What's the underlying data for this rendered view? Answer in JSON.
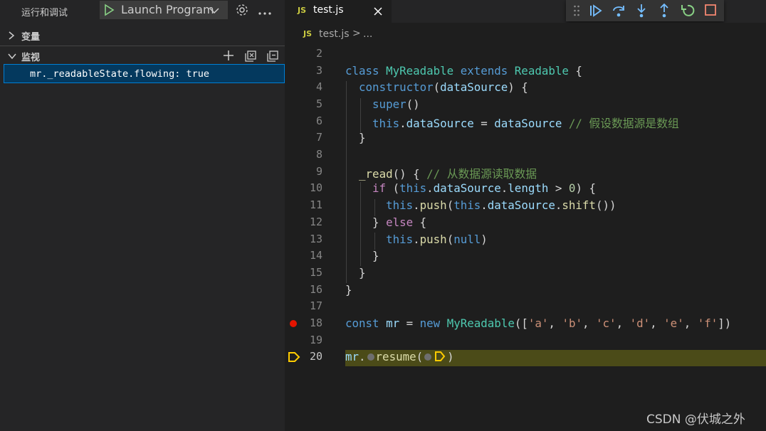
{
  "left_panel": {
    "run_title": "运行和调试",
    "launch_config": "Launch Program",
    "sections": {
      "variables": "变量",
      "watch": "监视"
    },
    "watch_items": [
      {
        "expr": "mr._readableState.flowing",
        "value": "true",
        "display": "mr._readableState.flowing: true"
      }
    ]
  },
  "editor": {
    "tab": {
      "icon": "JS",
      "name": "test.js"
    },
    "breadcrumb": {
      "icon": "JS",
      "file": "test.js",
      "separator": ">",
      "more": "..."
    },
    "breakpoint_line": 18,
    "current_line": 20,
    "lines": [
      {
        "n": "2"
      },
      {
        "n": "3"
      },
      {
        "n": "4"
      },
      {
        "n": "5"
      },
      {
        "n": "6"
      },
      {
        "n": "7"
      },
      {
        "n": "8"
      },
      {
        "n": "9"
      },
      {
        "n": "10"
      },
      {
        "n": "11"
      },
      {
        "n": "12"
      },
      {
        "n": "13"
      },
      {
        "n": "14"
      },
      {
        "n": "15"
      },
      {
        "n": "16"
      },
      {
        "n": "17"
      },
      {
        "n": "18"
      },
      {
        "n": "19"
      },
      {
        "n": "20"
      }
    ],
    "code": {
      "l3": {
        "t1": "class",
        "t2": "MyReadable",
        "t3": "extends",
        "t4": "Readable",
        "t5": " {"
      },
      "l4": {
        "t1": "constructor",
        "t2": "(",
        "t3": "dataSource",
        "t4": ") {"
      },
      "l5": {
        "t1": "super",
        "t2": "()"
      },
      "l6": {
        "t1": "this",
        "t2": ".",
        "t3": "dataSource",
        "t4": " = ",
        "t5": "dataSource",
        "t6": " // 假设数据源是数组"
      },
      "l7": {
        "t1": "}"
      },
      "l9": {
        "t1": "_read",
        "t2": "() { ",
        "t3": "// 从数据源读取数据"
      },
      "l10": {
        "t1": "if",
        "t2": " (",
        "t3": "this",
        "t4": ".",
        "t5": "dataSource",
        "t6": ".",
        "t7": "length",
        "t8": " > ",
        "t9": "0",
        "t10": ") {"
      },
      "l11": {
        "t1": "this",
        "t2": ".",
        "t3": "push",
        "t4": "(",
        "t5": "this",
        "t6": ".",
        "t7": "dataSource",
        "t8": ".",
        "t9": "shift",
        "t10": "())"
      },
      "l12": {
        "t1": "} ",
        "t2": "else",
        "t3": " {"
      },
      "l13": {
        "t1": "this",
        "t2": ".",
        "t3": "push",
        "t4": "(",
        "t5": "null",
        "t6": ")"
      },
      "l14": {
        "t1": "}"
      },
      "l15": {
        "t1": "}"
      },
      "l16": {
        "t1": "}"
      },
      "l18": {
        "t1": "const",
        "t2": "mr",
        "t3": " = ",
        "t4": "new",
        "t5": "MyReadable",
        "t6": "([",
        "t7": "'a'",
        "t8": ", ",
        "t9": "'b'",
        "t10": ", ",
        "t11": "'c'",
        "t12": ", ",
        "t13": "'d'",
        "t14": ", ",
        "t15": "'e'",
        "t16": ", ",
        "t17": "'f'",
        "t18": "])"
      },
      "l20": {
        "t1": "mr",
        "t2": ".",
        "t3": "resume",
        "t4": "(",
        "t5": ")"
      }
    }
  },
  "watermark": "CSDN @伏城之外",
  "colors": {
    "breakpoint": "#e51400",
    "current_line_arrow": "#ffcc00",
    "accent": "#007fd4"
  }
}
